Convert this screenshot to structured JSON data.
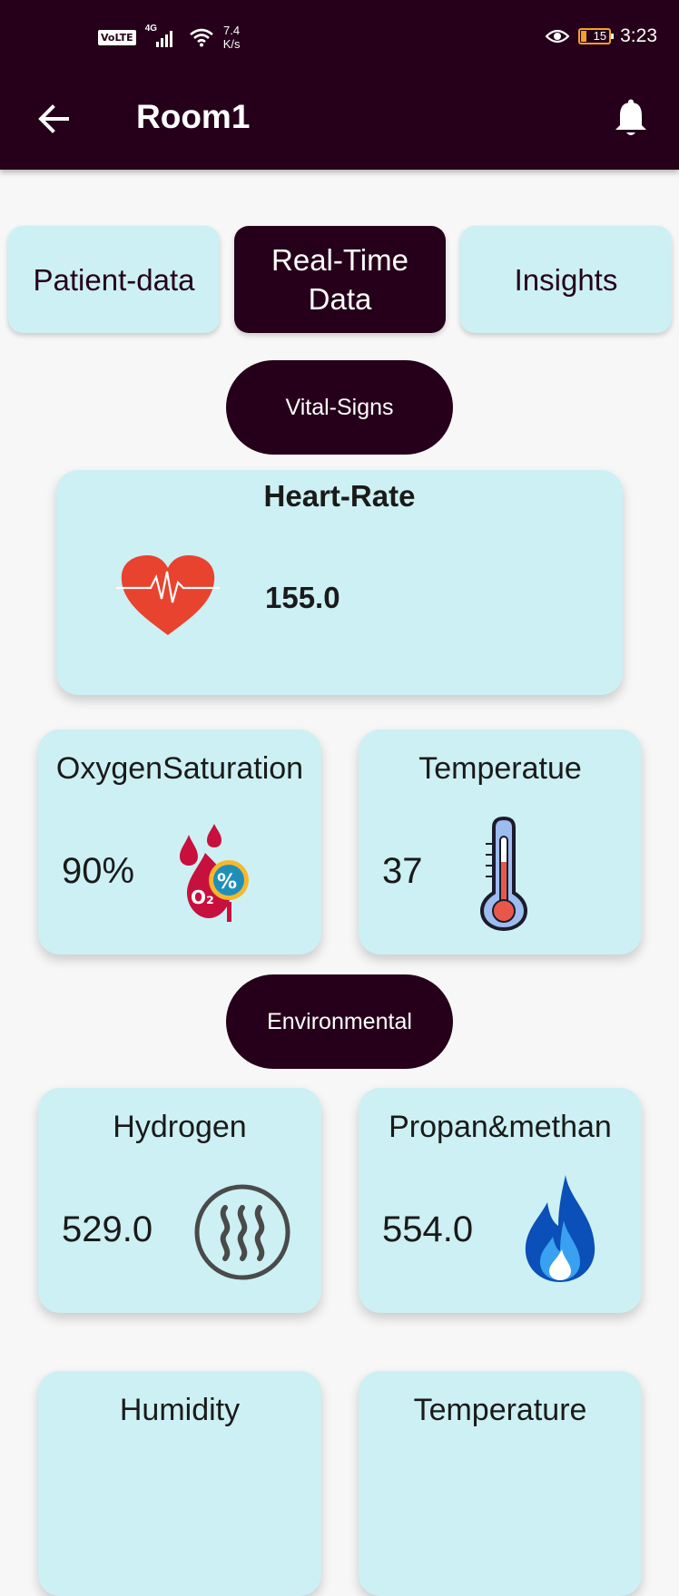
{
  "status_bar": {
    "volte": "VoLTE",
    "network": "4G",
    "speed_value": "7.4",
    "speed_unit": "K/s",
    "battery": "15",
    "time": "3:23"
  },
  "header": {
    "title": "Room1",
    "back_icon": "arrow-left-icon",
    "notification_icon": "bell-icon"
  },
  "tabs": [
    {
      "label": "Patient-data",
      "active": false
    },
    {
      "label": "Real-Time Data",
      "active": true
    },
    {
      "label": "Insights",
      "active": false
    }
  ],
  "sections": {
    "vital_signs": "Vital-Signs",
    "environmental": "Environmental"
  },
  "cards": {
    "heart_rate": {
      "title": "Heart-Rate",
      "value": "155.0",
      "icon": "heart-pulse-icon"
    },
    "oxygen": {
      "title": "OxygenSaturation",
      "value": "90%",
      "icon": "oxygen-drop-icon"
    },
    "body_temperature": {
      "title": "Temperatue",
      "value": "37",
      "icon": "thermometer-icon"
    },
    "hydrogen": {
      "title": "Hydrogen",
      "value": "529.0",
      "icon": "steam-icon"
    },
    "propane_methane": {
      "title": "Propan&methan",
      "value": "554.0",
      "icon": "flame-icon"
    },
    "humidity": {
      "title": "Humidity"
    },
    "room_temperature": {
      "title": "Temperature"
    }
  },
  "colors": {
    "primary": "#26001a",
    "card_background": "#ccf0f3",
    "page_background": "#f7f7f7",
    "heart": "#e8432f",
    "flame": "#0b4fb8"
  }
}
